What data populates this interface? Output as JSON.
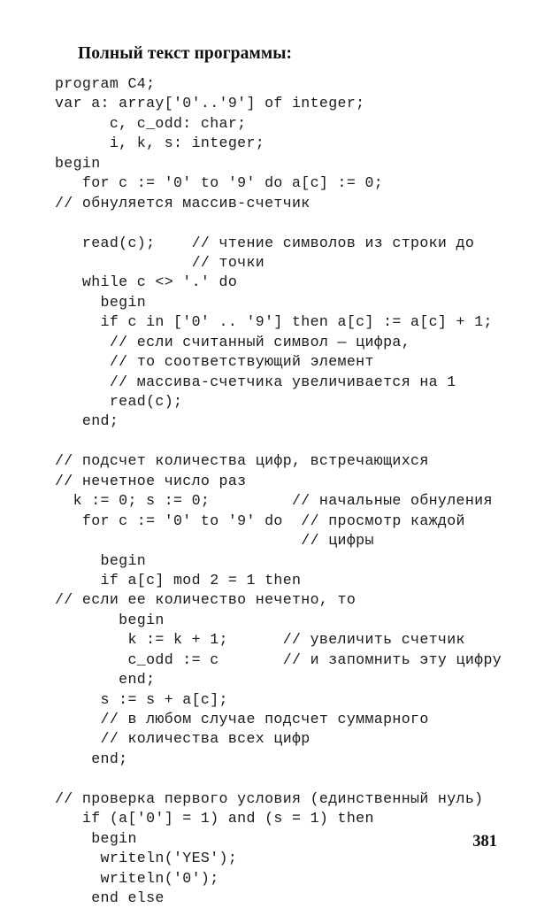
{
  "page": {
    "heading": "Полный текст программы:",
    "page_number": "381",
    "background_color": "#ffffff",
    "text_color": "#1a1a1a"
  },
  "listing": {
    "language": "pascal",
    "lines": [
      "program C4;",
      "var a: array['0'..'9'] of integer;",
      "      c, c_odd: char;",
      "      i, k, s: integer;",
      "begin",
      "   for c := '0' to '9' do a[c] := 0;",
      "// обнуляется массив-счетчик",
      "",
      "   read(c);    // чтение символов из строки до",
      "               // точки",
      "   while c <> '.' do",
      "     begin",
      "     if c in ['0' .. '9'] then a[c] := a[c] + 1;",
      "      // если считанный символ — цифра,",
      "      // то соответствующий элемент",
      "      // массива-счетчика увеличивается на 1",
      "      read(c);",
      "   end;",
      "",
      "// подсчет количества цифр, встречающихся",
      "// нечетное число раз",
      "  k := 0; s := 0;         // начальные обнуления",
      "   for c := '0' to '9' do  // просмотр каждой",
      "                           // цифры",
      "     begin",
      "     if a[c] mod 2 = 1 then",
      "// если ее количество нечетно, то",
      "       begin",
      "        k := k + 1;      // увеличить счетчик",
      "        c_odd := c       // и запомнить эту цифру",
      "       end;",
      "     s := s + a[c];",
      "     // в любом случае подсчет суммарного",
      "     // количества всех цифр",
      "    end;",
      "",
      "// проверка первого условия (единственный нуль)",
      "   if (a['0'] = 1) and (s = 1) then",
      "    begin",
      "     writeln('YES');",
      "     writeln('0');",
      "    end else"
    ]
  }
}
